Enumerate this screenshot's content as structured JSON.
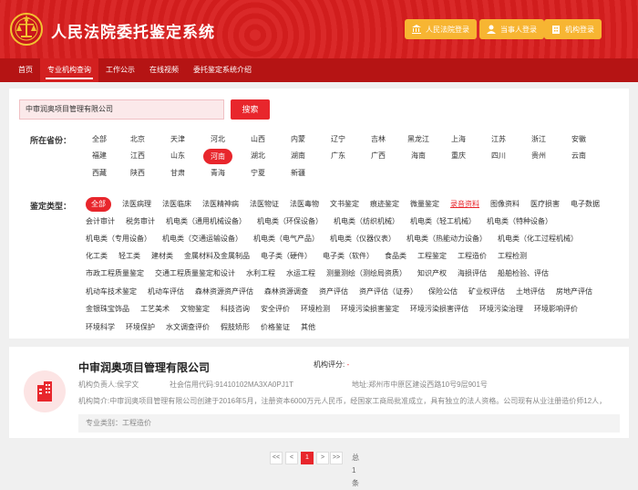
{
  "header": {
    "title": "人民法院委托鉴定系统",
    "buttons": [
      {
        "label": "人民法院登录",
        "icon": "court-icon"
      },
      {
        "label": "当事人登录",
        "icon": "user-icon"
      },
      {
        "label": "机构登录",
        "icon": "institution-icon"
      }
    ]
  },
  "nav": [
    "首页",
    "专业机构查询",
    "工作公示",
    "在线视频",
    "委托鉴定系统介绍"
  ],
  "search": {
    "value": "中审润奥项目管理有限公司",
    "button": "搜索"
  },
  "province_label": "所在省份：",
  "provinces": [
    [
      "全部",
      "北京",
      "天津",
      "河北",
      "山西",
      "内蒙",
      "辽宁",
      "吉林",
      "黑龙江",
      "上海",
      "江苏",
      "浙江",
      "安徽"
    ],
    [
      "福建",
      "江西",
      "山东",
      "河南",
      "湖北",
      "湖南",
      "广东",
      "广西",
      "海南",
      "重庆",
      "四川",
      "贵州",
      "云南"
    ],
    [
      "西藏",
      "陕西",
      "甘肃",
      "青海",
      "宁夏",
      "新疆"
    ]
  ],
  "selected_province": "河南",
  "type_label": "鉴定类型：",
  "types": [
    [
      "全部",
      "法医病理",
      "法医临床",
      "法医精神病",
      "法医物证",
      "法医毒物",
      "文书鉴定",
      "痕迹鉴定",
      "微量鉴定",
      "录音资料",
      "图像资料",
      "医疗损害",
      "电子数据"
    ],
    [
      "会计审计",
      "税务审计",
      "机电类（通用机械设备）",
      "机电类（环保设备）",
      "机电类（纺织机械）",
      "机电类（轻工机械）",
      "机电类（特种设备）"
    ],
    [
      "机电类（专用设备）",
      "机电类（交通运输设备）",
      "机电类（电气产品）",
      "机电类（仪器仪表）",
      "机电类（热能动力设备）",
      "机电类（化工过程机械）"
    ],
    [
      "化工类",
      "轻工类",
      "建材类",
      "金属材料及金属制品",
      "电子类（硬件）",
      "电子类（软件）",
      "食品类",
      "工程鉴定",
      "工程造价",
      "工程检测"
    ],
    [
      "市政工程质量鉴定",
      "交通工程质量鉴定和设计",
      "水利工程",
      "水运工程",
      "测量测绘（测绘局资质）",
      "知识产权",
      "海损评估",
      "船舶检验、评估"
    ],
    [
      "机动车技术鉴定",
      "机动车评估",
      "森林资源资产评估",
      "森林资源调查",
      "资产评估",
      "资产评估（证券）",
      "保险公估",
      "矿业权评估",
      "土地评估",
      "房地产评估"
    ],
    [
      "金银珠宝饰品",
      "工艺美术",
      "文物鉴定",
      "科技咨询",
      "安全评价",
      "环境检测",
      "环境污染损害鉴定",
      "环境污染损害评估",
      "环境污染治理",
      "环境影响评价"
    ],
    [
      "环境科学",
      "环境保护",
      "水文调查评价",
      "假肢矫形",
      "价格鉴证",
      "其他"
    ]
  ],
  "selected_type": "全部",
  "highlight_type": "录音资料",
  "result": {
    "name": "中审润奥项目管理有限公司",
    "rating_label": "机构评分:",
    "rating_value": "-",
    "principal": "机构负责人:侯学文",
    "credit_code": "社会信用代码:91410102MA3XA0PJ1T",
    "address": "地址:郑州市中原区建设西路10号9层901号",
    "intro": "机构简介:中审润奥项目管理有限公司创建于2016年5月，注册资本6000万元人民币，经国家工商局批准成立，具有独立的法人资格。公司现有从业注册造价师12人，",
    "category": "专业类别：工程造价"
  },
  "pager": {
    "first": "<<",
    "prev": "<",
    "current": "1",
    "next": ">",
    "last": ">>",
    "total": "总1条"
  },
  "colors": {
    "primary": "#d81e1e",
    "accent": "#e8262c",
    "gold": "#f7b532"
  }
}
